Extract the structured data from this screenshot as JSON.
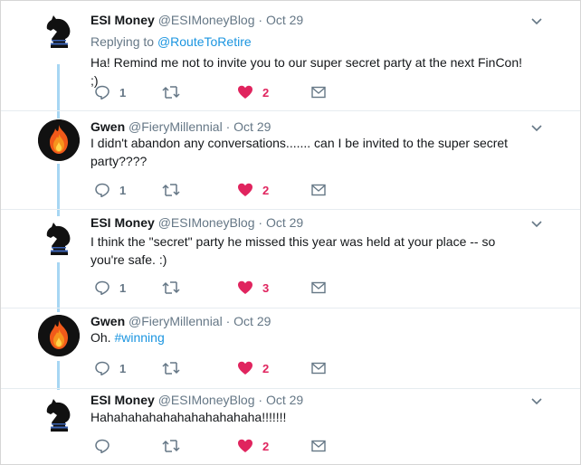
{
  "colors": {
    "link": "#1b95e0",
    "like": "#e0245e",
    "meta": "#657786",
    "thread_line": "#a7d6f3"
  },
  "tweets": [
    {
      "name": "ESI Money",
      "handle": "@ESIMoneyBlog",
      "separator": "·",
      "date": "Oct 29",
      "avatar_icon": "knight-chess-piece-avatar",
      "replying_label": "Replying to",
      "replying_handle": "@RouteToRetire",
      "text_lines": [
        "Ha! Remind me not to invite you to our super secret party at the next FinCon! ;)"
      ],
      "replies": "1",
      "likes": "2"
    },
    {
      "name": "Gwen",
      "handle": "@FieryMillennial",
      "separator": "·",
      "date": "Oct 29",
      "avatar_icon": "fire-avatar",
      "text_lines": [
        "I didn't abandon any conversations....... can I be invited to the super secret",
        "party????"
      ],
      "replies": "1",
      "likes": "2"
    },
    {
      "name": "ESI Money",
      "handle": "@ESIMoneyBlog",
      "separator": "·",
      "date": "Oct 29",
      "avatar_icon": "knight-chess-piece-avatar",
      "text_lines": [
        "I think the \"secret\" party he missed this year was held at your place -- so",
        "you're safe. :)"
      ],
      "replies": "1",
      "likes": "3"
    },
    {
      "name": "Gwen",
      "handle": "@FieryMillennial",
      "separator": "·",
      "date": "Oct 29",
      "avatar_icon": "fire-avatar",
      "text_prefix": "Oh. ",
      "hashtag": "#winning",
      "replies": "1",
      "likes": "2"
    },
    {
      "name": "ESI Money",
      "handle": "@ESIMoneyBlog",
      "separator": "·",
      "date": "Oct 29",
      "avatar_icon": "knight-chess-piece-avatar",
      "text_lines": [
        "Hahahahahahahahahahahaha!!!!!!!"
      ],
      "replies": "",
      "likes": "2"
    }
  ]
}
